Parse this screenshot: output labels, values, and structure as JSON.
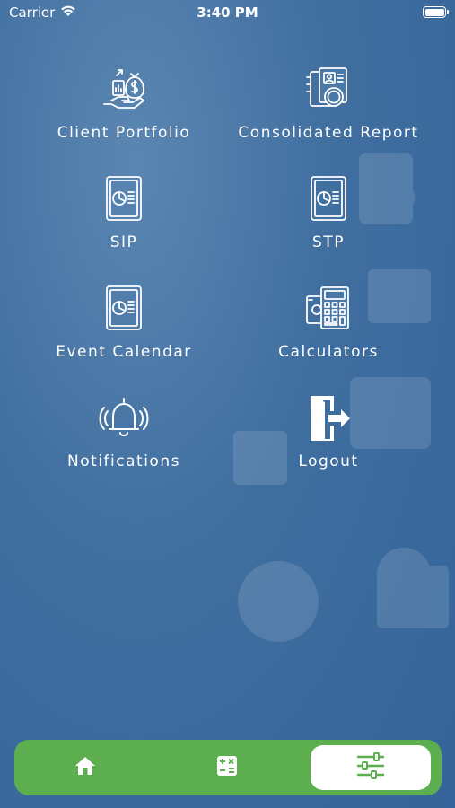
{
  "status_bar": {
    "carrier": "Carrier",
    "time": "3:40 PM",
    "wifi_icon": "wifi-icon",
    "battery_icon": "battery-icon"
  },
  "menu": {
    "items": [
      {
        "label": "Client Portfolio",
        "icon": "money-bag-hand-icon"
      },
      {
        "label": "Consolidated Report",
        "icon": "report-coin-icon"
      },
      {
        "label": "SIP",
        "icon": "pie-chart-document-icon"
      },
      {
        "label": "STP",
        "icon": "pie-chart-document-icon"
      },
      {
        "label": "Event Calendar",
        "icon": "pie-chart-document-icon"
      },
      {
        "label": "Calculators",
        "icon": "calculator-icon"
      },
      {
        "label": "Notifications",
        "icon": "bell-icon"
      },
      {
        "label": "Logout",
        "icon": "logout-icon"
      }
    ]
  },
  "bottom_nav": {
    "items": [
      {
        "icon": "home-icon",
        "active": false
      },
      {
        "icon": "calculator-icon",
        "active": false
      },
      {
        "icon": "sliders-icon",
        "active": true
      }
    ]
  },
  "colors": {
    "background": "#3f6e9f",
    "nav_green": "#5cae4e",
    "active_tab": "#ffffff"
  }
}
